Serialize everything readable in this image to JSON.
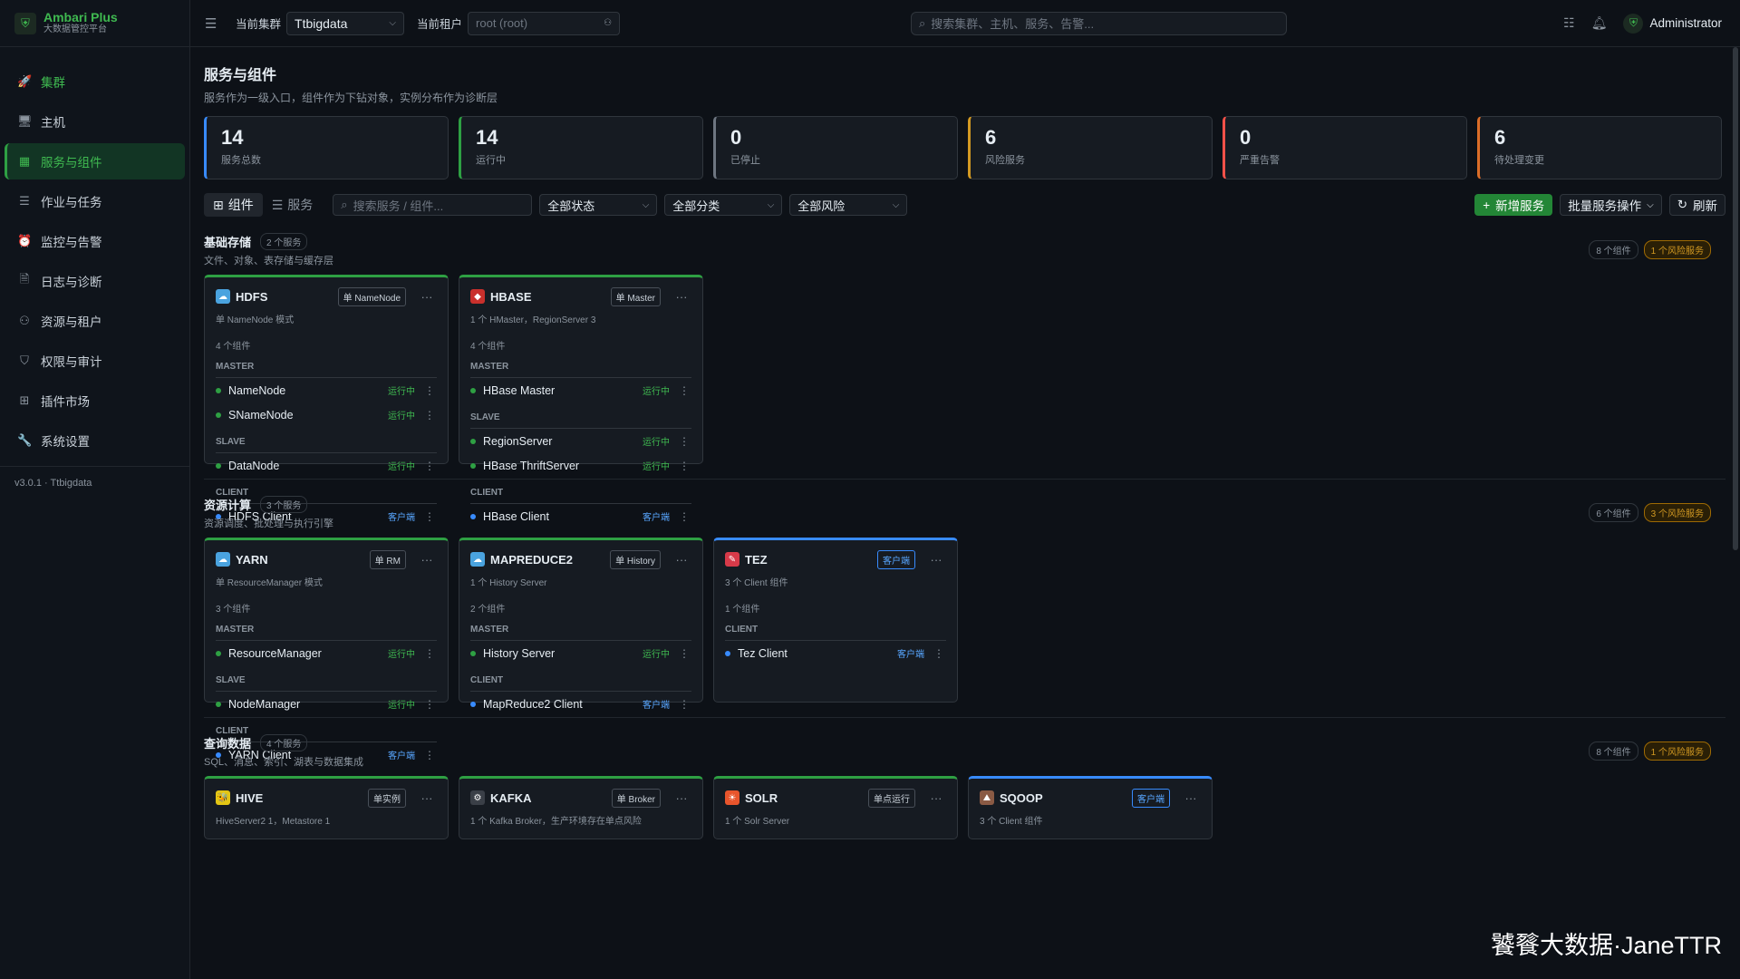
{
  "brand": {
    "name": "Ambari Plus",
    "sub": "大数据管控平台"
  },
  "nav": [
    {
      "label": "集群",
      "icon": "🚀"
    },
    {
      "label": "主机",
      "icon": "🖥"
    },
    {
      "label": "服务与组件",
      "icon": "▦"
    },
    {
      "label": "作业与任务",
      "icon": "☰"
    },
    {
      "label": "监控与告警",
      "icon": "⏰"
    },
    {
      "label": "日志与诊断",
      "icon": "🗎"
    },
    {
      "label": "资源与租户",
      "icon": "⚇"
    },
    {
      "label": "权限与审计",
      "icon": "⛉"
    },
    {
      "label": "插件市场",
      "icon": "⊞"
    },
    {
      "label": "系统设置",
      "icon": "🔧"
    }
  ],
  "version": "v3.0.1 · Ttbigdata",
  "topbar": {
    "cluster_label": "当前集群",
    "cluster_value": "Ttbigdata",
    "tenant_label": "当前租户",
    "tenant_placeholder": "root (root)",
    "search_placeholder": "搜索集群、主机、服务、告警...",
    "user": "Administrator"
  },
  "page": {
    "title": "服务与组件",
    "subtitle": "服务作为一级入口，组件作为下钻对象，实例分布作为诊断层"
  },
  "stats": [
    {
      "value": "14",
      "label": "服务总数",
      "color": "#388bfd"
    },
    {
      "value": "14",
      "label": "运行中",
      "color": "#2ea043"
    },
    {
      "value": "0",
      "label": "已停止",
      "color": "#6e7681"
    },
    {
      "value": "6",
      "label": "风险服务",
      "color": "#d29922"
    },
    {
      "value": "0",
      "label": "严重告警",
      "color": "#f85149"
    },
    {
      "value": "6",
      "label": "待处理变更",
      "color": "#db6d28"
    }
  ],
  "toolbar": {
    "view_components": "组件",
    "view_services": "服务",
    "search_placeholder": "搜索服务 / 组件...",
    "filter_status": "全部状态",
    "filter_category": "全部分类",
    "filter_risk": "全部风险",
    "add_service": "新增服务",
    "batch_ops": "批量服务操作",
    "refresh": "刷新"
  },
  "sections": [
    {
      "title": "基础存储",
      "count": "2 个服务",
      "desc": "文件、对象、表存储与缓存层",
      "components_badge": "8 个组件",
      "risk_badge": "1 个风险服务",
      "cards": [
        {
          "name": "HDFS",
          "icon_color": "#4aa3df",
          "icon": "☁",
          "tag": "单 NameNode",
          "tag_style": "",
          "desc": "单 NameNode 模式",
          "comp_count": "4 个组件",
          "groups": [
            {
              "role": "MASTER",
              "items": [
                {
                  "name": "NameNode",
                  "status": "运行中",
                  "type": "run"
                },
                {
                  "name": "SNameNode",
                  "status": "运行中",
                  "type": "run"
                }
              ]
            },
            {
              "role": "SLAVE",
              "items": [
                {
                  "name": "DataNode",
                  "status": "运行中",
                  "type": "run"
                }
              ]
            },
            {
              "role": "CLIENT",
              "items": [
                {
                  "name": "HDFS Client",
                  "status": "客户端",
                  "type": "client"
                }
              ]
            }
          ]
        },
        {
          "name": "HBASE",
          "icon_color": "#c9302c",
          "icon": "◆",
          "tag": "单 Master",
          "tag_style": "",
          "desc": "1 个 HMaster，RegionServer 3",
          "comp_count": "4 个组件",
          "groups": [
            {
              "role": "MASTER",
              "items": [
                {
                  "name": "HBase Master",
                  "status": "运行中",
                  "type": "run"
                }
              ]
            },
            {
              "role": "SLAVE",
              "items": [
                {
                  "name": "RegionServer",
                  "status": "运行中",
                  "type": "run"
                },
                {
                  "name": "HBase ThriftServer",
                  "status": "运行中",
                  "type": "run"
                }
              ]
            },
            {
              "role": "CLIENT",
              "items": [
                {
                  "name": "HBase Client",
                  "status": "客户端",
                  "type": "client"
                }
              ]
            }
          ]
        }
      ]
    },
    {
      "title": "资源计算",
      "count": "3 个服务",
      "desc": "资源调度、批处理与执行引擎",
      "components_badge": "6 个组件",
      "risk_badge": "3 个风险服务",
      "cards": [
        {
          "name": "YARN",
          "icon_color": "#4aa3df",
          "icon": "☁",
          "tag": "单 RM",
          "tag_style": "",
          "desc": "单 ResourceManager 模式",
          "comp_count": "3 个组件",
          "groups": [
            {
              "role": "MASTER",
              "items": [
                {
                  "name": "ResourceManager",
                  "status": "运行中",
                  "type": "run"
                }
              ]
            },
            {
              "role": "SLAVE",
              "items": [
                {
                  "name": "NodeManager",
                  "status": "运行中",
                  "type": "run"
                }
              ]
            },
            {
              "role": "CLIENT",
              "items": [
                {
                  "name": "YARN Client",
                  "status": "客户端",
                  "type": "client"
                }
              ]
            }
          ]
        },
        {
          "name": "MAPREDUCE2",
          "icon_color": "#4aa3df",
          "icon": "☁",
          "tag": "单 History",
          "tag_style": "",
          "desc": "1 个 History Server",
          "comp_count": "2 个组件",
          "groups": [
            {
              "role": "MASTER",
              "items": [
                {
                  "name": "History Server",
                  "status": "运行中",
                  "type": "run"
                }
              ]
            },
            {
              "role": "CLIENT",
              "items": [
                {
                  "name": "MapReduce2 Client",
                  "status": "客户端",
                  "type": "client"
                }
              ]
            }
          ]
        },
        {
          "name": "TEZ",
          "icon_color": "#d73a49",
          "icon": "✎",
          "tag": "客户端",
          "tag_style": "blue",
          "card_style": "blue",
          "desc": "3 个 Client 组件",
          "comp_count": "1 个组件",
          "groups": [
            {
              "role": "CLIENT",
              "items": [
                {
                  "name": "Tez Client",
                  "status": "客户端",
                  "type": "client"
                }
              ]
            }
          ]
        }
      ]
    },
    {
      "title": "查询数据",
      "count": "4 个服务",
      "desc": "SQL、消息、索引、湖表与数据集成",
      "components_badge": "8 个组件",
      "risk_badge": "1 个风险服务",
      "cards": [
        {
          "name": "HIVE",
          "icon_color": "#e3c514",
          "icon": "🐝",
          "tag": "单实例",
          "tag_style": "",
          "desc": "HiveServer2 1，Metastore 1",
          "comp_count": "",
          "groups": []
        },
        {
          "name": "KAFKA",
          "icon_color": "#3a3f47",
          "icon": "⚙",
          "tag": "单 Broker",
          "tag_style": "",
          "desc": "1 个 Kafka Broker，生产环境存在单点风险",
          "comp_count": "",
          "groups": []
        },
        {
          "name": "SOLR",
          "icon_color": "#e8552c",
          "icon": "☀",
          "tag": "单点运行",
          "tag_style": "",
          "desc": "1 个 Solr Server",
          "comp_count": "",
          "groups": []
        },
        {
          "name": "SQOOP",
          "icon_color": "#8a5a44",
          "icon": "⛰",
          "tag": "客户端",
          "tag_style": "blue",
          "card_style": "blue",
          "desc": "3 个 Client 组件",
          "comp_count": "",
          "groups": []
        }
      ]
    }
  ],
  "watermark": "饕餮大数据·JaneTTR"
}
